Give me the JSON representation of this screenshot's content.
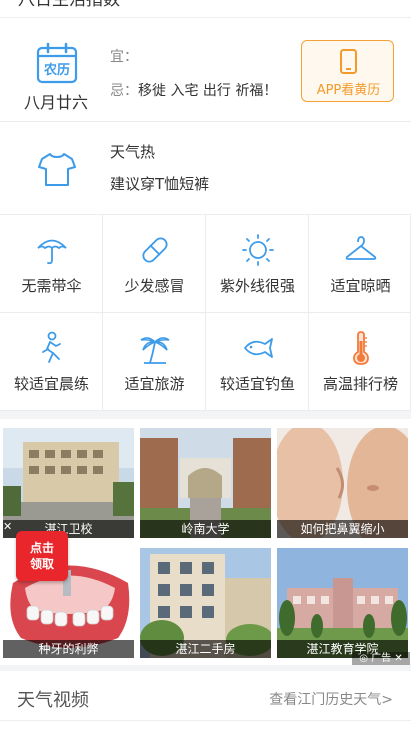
{
  "header": {
    "title": "八日生活指数"
  },
  "almanac": {
    "calendar_label": "农历",
    "lunar_date": "八月廿六",
    "yi_label": "宜：",
    "yi_value": "",
    "ji_label": "忌：",
    "ji_value": "移徙 入宅 出行 祈福！",
    "app_button": "APP看黄历",
    "accent_color": "#3d9be9",
    "app_color": "#f29b2c"
  },
  "weather_tip": {
    "line1": "天气热",
    "line2": "建议穿T恤短裤"
  },
  "indices": [
    {
      "icon": "umbrella-icon",
      "label": "无需带伞"
    },
    {
      "icon": "pill-icon",
      "label": "少发感冒"
    },
    {
      "icon": "sun-icon",
      "label": "紫外线很强"
    },
    {
      "icon": "hanger-icon",
      "label": "适宜晾晒"
    },
    {
      "icon": "runner-icon",
      "label": "较适宜晨练"
    },
    {
      "icon": "palm-tree-icon",
      "label": "适宜旅游"
    },
    {
      "icon": "fish-icon",
      "label": "较适宜钓鱼"
    },
    {
      "icon": "thermometer-icon",
      "label": "高温排行榜"
    }
  ],
  "ads": {
    "items": [
      {
        "caption": "湛江卫校"
      },
      {
        "caption": "岭南大学"
      },
      {
        "caption": "如何把鼻翼缩小"
      },
      {
        "caption": "种牙的利弊"
      },
      {
        "caption": "湛江二手房"
      },
      {
        "caption": "湛江教育学院"
      }
    ],
    "close": "✕",
    "promo_line1": "点击",
    "promo_line2": "领取",
    "ad_mark": "◎ 广告 ✕"
  },
  "video": {
    "title": "天气视频",
    "link": "查看江门历史天气>"
  }
}
